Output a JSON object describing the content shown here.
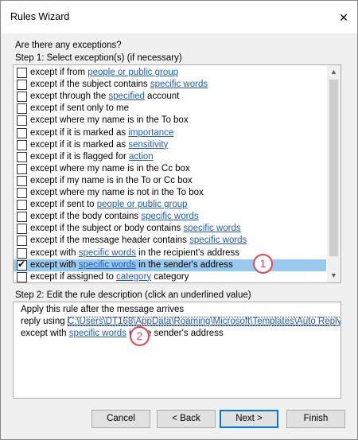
{
  "window": {
    "title": "Rules Wizard",
    "close_glyph": "✕"
  },
  "labels": {
    "question": "Are there any exceptions?",
    "step1": "Step 1: Select exception(s) (if necessary)",
    "step2": "Step 2: Edit the rule description (click an underlined value)"
  },
  "exceptions": [
    {
      "pre": "except if from ",
      "link": "people or public group",
      "post": "",
      "checked": false
    },
    {
      "pre": "except if the subject contains ",
      "link": "specific words",
      "post": "",
      "checked": false
    },
    {
      "pre": "except through the ",
      "link": "specified",
      "post": " account",
      "checked": false
    },
    {
      "pre": "except if sent only to me",
      "link": "",
      "post": "",
      "checked": false
    },
    {
      "pre": "except where my name is in the To box",
      "link": "",
      "post": "",
      "checked": false
    },
    {
      "pre": "except if it is marked as ",
      "link": "importance",
      "post": "",
      "checked": false
    },
    {
      "pre": "except if it is marked as ",
      "link": "sensitivity",
      "post": "",
      "checked": false
    },
    {
      "pre": "except if it is flagged for ",
      "link": "action",
      "post": "",
      "checked": false
    },
    {
      "pre": "except where my name is in the Cc box",
      "link": "",
      "post": "",
      "checked": false
    },
    {
      "pre": "except if my name is in the To or Cc box",
      "link": "",
      "post": "",
      "checked": false
    },
    {
      "pre": "except where my name is not in the To box",
      "link": "",
      "post": "",
      "checked": false
    },
    {
      "pre": "except if sent to ",
      "link": "people or public group",
      "post": "",
      "checked": false
    },
    {
      "pre": "except if the body contains ",
      "link": "specific words",
      "post": "",
      "checked": false
    },
    {
      "pre": "except if the subject or body contains ",
      "link": "specific words",
      "post": "",
      "checked": false
    },
    {
      "pre": "except if the message header contains ",
      "link": "specific words",
      "post": "",
      "checked": false
    },
    {
      "pre": "except with ",
      "link": "specific words",
      "post": " in the recipient's address",
      "checked": false
    },
    {
      "pre": "except with ",
      "link": "specific words",
      "post": " in the sender's address",
      "checked": true,
      "selected": true
    },
    {
      "pre": "except if assigned to ",
      "link": "category",
      "post": " category",
      "checked": false
    }
  ],
  "description": {
    "line1": "Apply this rule after the message arrives",
    "line2_pre": "reply using ",
    "line2_link": "C:\\Users\\DT168\\AppData\\Roaming\\Microsoft\\Templates\\Auto Reply",
    "line3_pre": "except with ",
    "line3_link": "specific words",
    "line3_post": " in the sender's address"
  },
  "buttons": {
    "cancel": "Cancel",
    "back": "< Back",
    "next": "Next >",
    "finish": "Finish"
  },
  "callouts": {
    "one": "1",
    "two": "2"
  },
  "colors": {
    "link": "#1f5bb7",
    "selection": "#99c9ef",
    "callout": "#e0485b",
    "default_button_border": "#0078d7"
  },
  "icons": {
    "scroll_up": "▲",
    "scroll_down": "▼"
  }
}
